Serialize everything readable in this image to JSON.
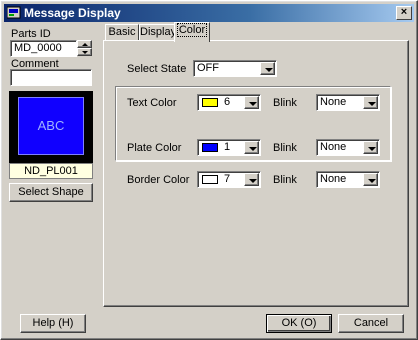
{
  "window": {
    "title": "Message Display",
    "close_glyph": "×"
  },
  "left": {
    "parts_id_label": "Parts ID",
    "parts_id_value": "MD_0000",
    "comment_label": "Comment",
    "comment_value": "",
    "preview_text": "ABC",
    "shape_name": "ND_PL001",
    "select_shape_label": "Select Shape"
  },
  "tabs": [
    {
      "label": "Basic",
      "active": false
    },
    {
      "label": "Display",
      "active": false
    },
    {
      "label": "Color",
      "active": true
    }
  ],
  "color": {
    "select_state_label": "Select State",
    "select_state_value": "OFF",
    "text_color_label": "Text Color",
    "text_color_value": "6",
    "text_color_hex": "#ffff00",
    "text_blink_label": "Blink",
    "text_blink_value": "None",
    "plate_color_label": "Plate Color",
    "plate_color_value": "1",
    "plate_color_hex": "#0000ff",
    "plate_blink_label": "Blink",
    "plate_blink_value": "None",
    "border_color_label": "Border Color",
    "border_color_value": "7",
    "border_color_hex": "#ffffff",
    "border_blink_label": "Blink",
    "border_blink_value": "None"
  },
  "footer": {
    "help_label": "Help (H)",
    "ok_label": "OK (O)",
    "cancel_label": "Cancel"
  },
  "colors": {
    "title_bar": "#0a246a",
    "face": "#d4d0c8",
    "preview_plate": "#1000ff",
    "preview_bg": "#000000"
  }
}
